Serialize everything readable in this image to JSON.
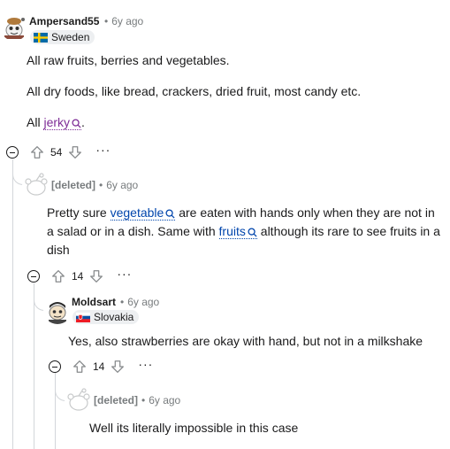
{
  "comments": [
    {
      "author": "Ampersand55",
      "time": "6y ago",
      "flair": "Sweden",
      "paragraphs": [
        "All raw fruits, berries and vegetables.",
        "All dry foods, like bread, crackers, dried fruit, most candy etc."
      ],
      "p3_prefix": "All ",
      "p3_keyword": "jerky",
      "p3_suffix": ".",
      "votes": "54"
    },
    {
      "author": "[deleted]",
      "time": "6y ago",
      "text_part1": "Pretty sure ",
      "keyword1": "vegetable",
      "text_part2": " are eaten with hands only when they are not in a salad or in a dish. Same with ",
      "keyword2": "fruits",
      "text_part3": " although its rare to see fruits in a dish",
      "votes": "14"
    },
    {
      "author": "Moldsart",
      "time": "6y ago",
      "flair": "Slovakia",
      "text": "Yes, also strawberries are okay with hand, but not in a milkshake",
      "votes": "14"
    },
    {
      "author": "[deleted]",
      "time": "6y ago",
      "text": "Well its literally impossible in this case"
    }
  ],
  "colors": {
    "keyword_blue": "#0045ac",
    "keyword_visited": "#7e2d96",
    "meta_gray": "#787c7e",
    "thread_line": "#d3d6da"
  },
  "icons": [
    "avatar-ampersand",
    "avatar-snoo-deleted",
    "avatar-moldsart",
    "sweden-flag",
    "slovakia-flag",
    "search-icon",
    "upvote-icon",
    "downvote-icon",
    "more-icon",
    "collapse-icon"
  ]
}
